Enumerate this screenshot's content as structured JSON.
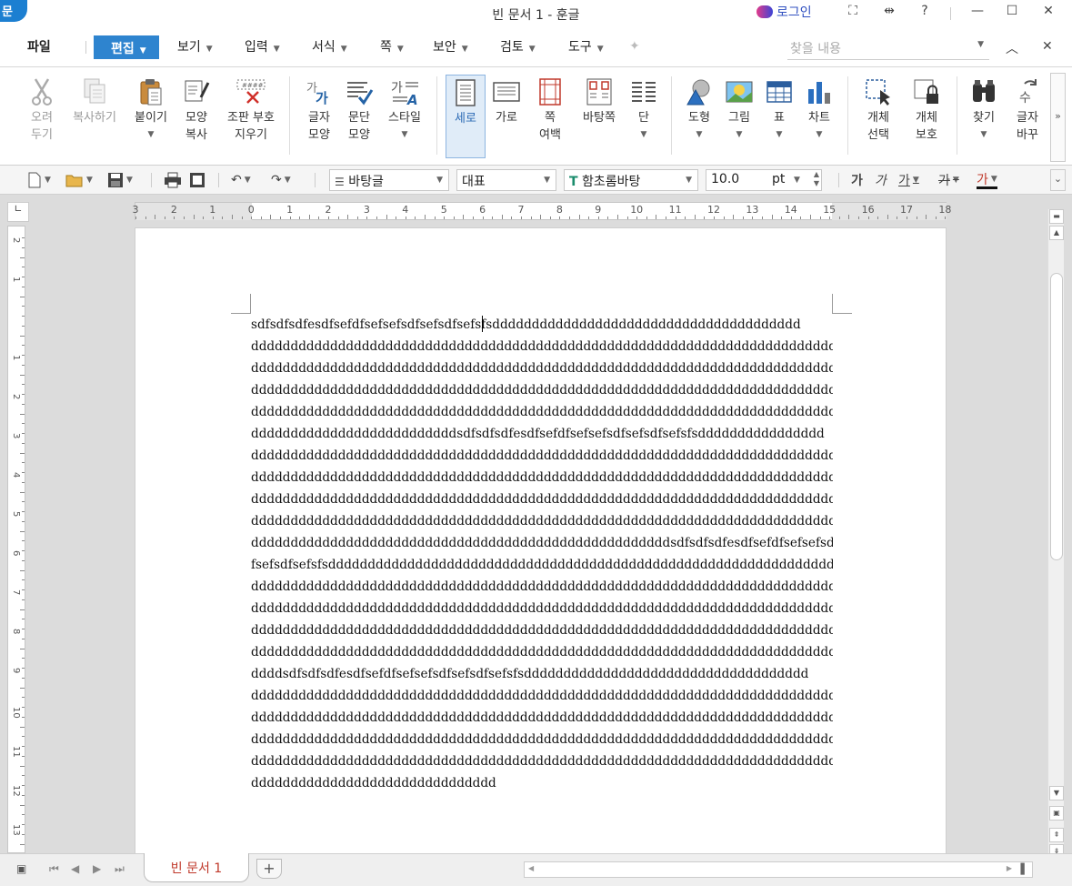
{
  "window": {
    "title": "빈 문서 1 - 훈글",
    "logo_text": "문",
    "login_label": "로그인",
    "controls": [
      "⛶",
      "⇹",
      "?",
      "—",
      "☐",
      "✕"
    ]
  },
  "menu": {
    "file": "파일",
    "active": "편집",
    "items": [
      "보기",
      "입력",
      "서식",
      "쪽",
      "보안",
      "검토",
      "도구"
    ],
    "search_placeholder": "찾을 내용"
  },
  "ribbon": {
    "buttons": [
      {
        "label": "오려\n두기",
        "icon": "scissors-icon",
        "disabled": true
      },
      {
        "label": "복사하기",
        "icon": "copy-icon",
        "disabled": true
      },
      {
        "label": "붙이기",
        "icon": "paste-icon",
        "dropdown": true
      },
      {
        "label": "모양\n복사",
        "icon": "format-painter-icon"
      },
      {
        "label": "조판 부호\n지우기",
        "icon": "clear-codes-icon"
      },
      {
        "label": "글자\n모양",
        "icon": "char-shape-icon"
      },
      {
        "label": "문단\n모양",
        "icon": "para-shape-icon"
      },
      {
        "label": "스타일",
        "icon": "style-icon",
        "dropdown": true
      },
      {
        "label": "세로",
        "icon": "portrait-icon",
        "active": true
      },
      {
        "label": "가로",
        "icon": "landscape-icon"
      },
      {
        "label": "쪽\n여백",
        "icon": "page-margin-icon",
        "dropdown": true
      },
      {
        "label": "바탕쪽",
        "icon": "master-page-icon"
      },
      {
        "label": "단",
        "icon": "columns-icon",
        "dropdown": true
      },
      {
        "label": "도형",
        "icon": "shape-icon",
        "dropdown": true
      },
      {
        "label": "그림",
        "icon": "picture-icon",
        "dropdown": true
      },
      {
        "label": "표",
        "icon": "table-icon",
        "dropdown": true
      },
      {
        "label": "차트",
        "icon": "chart-icon",
        "dropdown": true
      },
      {
        "label": "개체\n선택",
        "icon": "object-select-icon",
        "dropdown": true
      },
      {
        "label": "개체\n보호",
        "icon": "object-protect-icon",
        "dropdown": true
      },
      {
        "label": "찾기",
        "icon": "find-icon",
        "dropdown": true
      },
      {
        "label": "글자\n바꾸",
        "icon": "replace-icon"
      }
    ]
  },
  "format_bar": {
    "style": "바탕글",
    "language": "대표",
    "font": "함초롬바탕",
    "font_size": "10.0",
    "size_unit": "pt",
    "char_buttons": [
      "가",
      "가",
      "가",
      "가",
      "가"
    ]
  },
  "ruler": {
    "h_numbers": [
      "3",
      "2",
      "1",
      "0",
      "1",
      "2",
      "3",
      "4",
      "5",
      "6",
      "7",
      "8",
      "9",
      "10",
      "11",
      "12",
      "13",
      "14",
      "15",
      "16",
      "17",
      "18"
    ],
    "v_numbers": [
      "2",
      "1",
      "",
      "1",
      "2",
      "3",
      "4",
      "5",
      "6",
      "7",
      "8",
      "9",
      "10",
      "11",
      "12",
      "13"
    ]
  },
  "document": {
    "lines": [
      "sdfsdfsdfesdfsefdfsefsefsdfsefsdfsefsfsddddddddddddddddddddddddddddddddddddddd",
      "dddddddddddddddddddddddddddddddddddddddddddddddddddddddddddddddddddddddddddddd",
      "dddddddddddddddddddddddddddddddddddddddddddddddddddddddddddddddddddddddddddddd",
      "dddddddddddddddddddddddddddddddddddddddddddddddddddddddddddddddddddddddddddddd",
      "dddddddddddddddddddddddddddddddddddddddddddddddddddddddddddddddddddddddddddddd",
      "ddddddddddddddddddddddddddsdfsdfsdfesdfsefdfsefsefsdfsefsdfsefsfsdddddddddddddddd",
      "dddddddddddddddddddddddddddddddddddddddddddddddddddddddddddddddddddddddddddddd",
      "dddddddddddddddddddddddddddddddddddddddddddddddddddddddddddddddddddddddddddddd",
      "dddddddddddddddddddddddddddddddddddddddddddddddddddddddddddddddddddddddddddddd",
      "dddddddddddddddddddddddddddddddddddddddddddddddddddddddddddddddddddddddddddddd",
      "dddddddddddddddddddddddddddddddddddddddddddddddddddddsdfsdfsdfesdfsefdfsefsefsd",
      "fsefsdfsefsfsddddddddddddddddddddddddddddddddddddddddddddddddddddddddddddddddd",
      "dddddddddddddddddddddddddddddddddddddddddddddddddddddddddddddddddddddddddddddd",
      "dddddddddddddddddddddddddddddddddddddddddddddddddddddddddddddddddddddddddddddd",
      "dddddddddddddddddddddddddddddddddddddddddddddddddddddddddddddddddddddddddddddd",
      "dddddddddddddddddddddddddddddddddddddddddddddddddddddddddddddddddddddddddddddd",
      "ddddsdfsdfsdfesdfsefdfsefsefsdfsefsdfsefsfsdddddddddddddddddddddddddddddddddddd",
      "dddddddddddddddddddddddddddddddddddddddddddddddddddddddddddddddddddddddddddddd",
      "dddddddddddddddddddddddddddddddddddddddddddddddddddddddddddddddddddddddddddddd",
      "dddddddddddddddddddddddddddddddddddddddddddddddddddddddddddddddddddddddddddddd",
      "dddddddddddddddddddddddddddddddddddddddddddddddddddddddddddddddddddddddddddddd",
      "ddddddddddddddddddddddddddddddd"
    ]
  },
  "tabs": {
    "doc_tab": "빈 문서 1",
    "add_tab": "+"
  },
  "colors": {
    "accent": "#2e84cf",
    "tab_text": "#c0392b"
  }
}
